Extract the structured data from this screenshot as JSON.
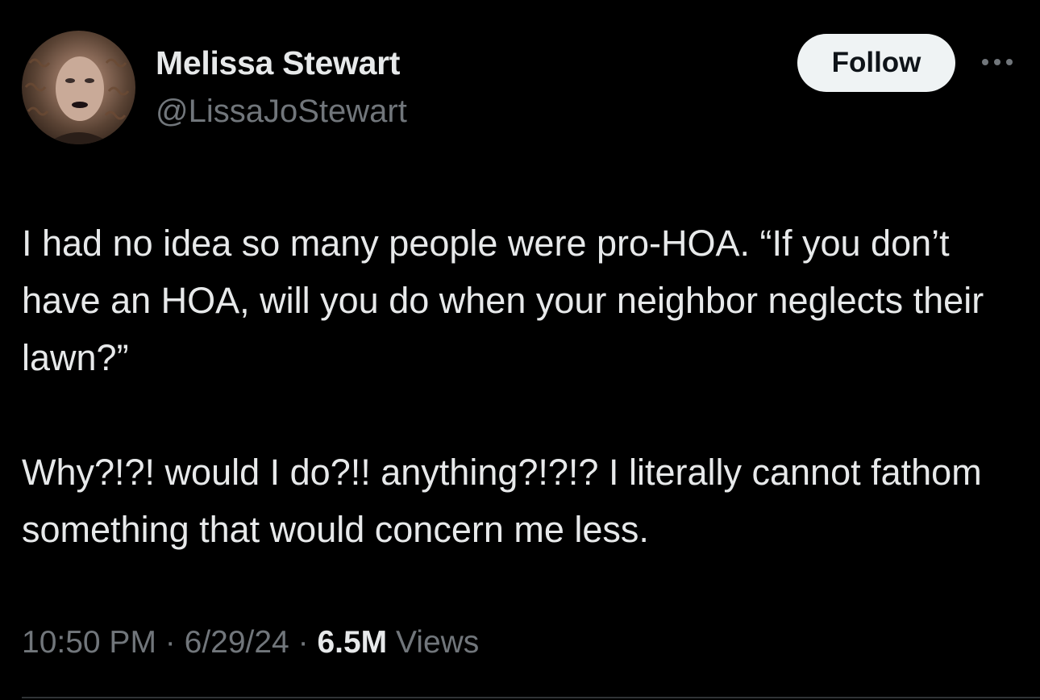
{
  "tweet": {
    "author": {
      "display_name": "Melissa Stewart",
      "handle": "@LissaJoStewart"
    },
    "follow_label": "Follow",
    "more_icon": "more-horizontal-icon",
    "text_paragraphs": [
      "I had no idea so many people were pro-HOA. “If you don’t have an HOA, will you do when your neighbor neglects their lawn?”",
      "Why?!?! would I do?!! anything?!?!? I literally cannot fathom something that would concern me less."
    ],
    "meta": {
      "time": "10:50 PM",
      "separator": "·",
      "date": "6/29/24",
      "views_count": "6.5M",
      "views_label": "Views"
    }
  },
  "colors": {
    "background": "#000000",
    "primary_text": "#e7e9ea",
    "secondary_text": "#71767b",
    "follow_button_bg": "#eff3f4",
    "follow_button_text": "#0f1419",
    "divider": "#2f3336"
  }
}
